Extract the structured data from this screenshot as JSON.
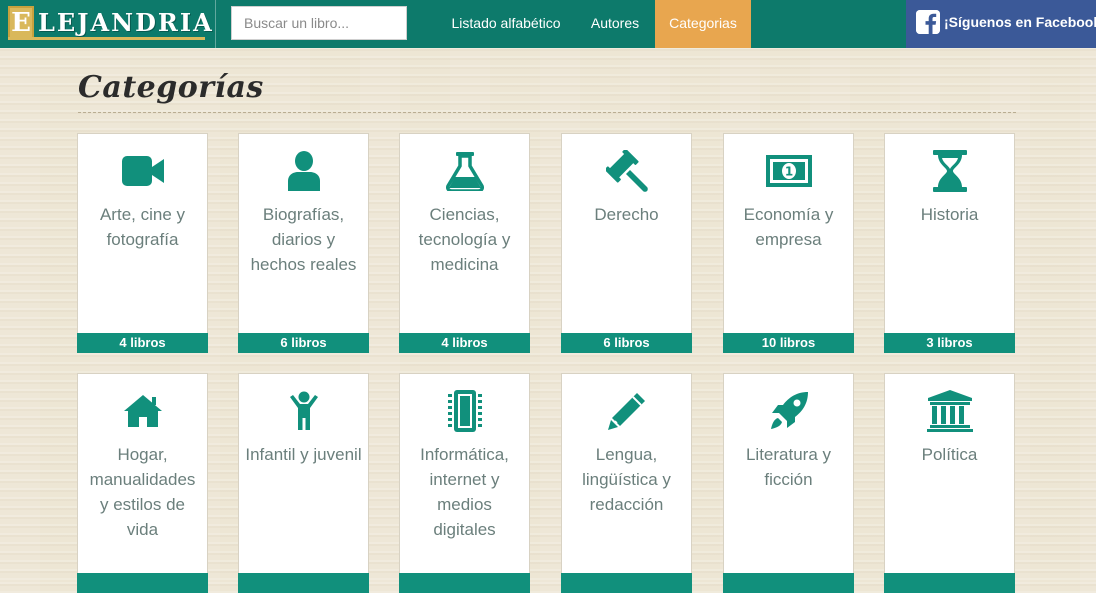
{
  "header": {
    "logo_first_letter": "E",
    "logo_rest": "LEJANDRIA",
    "search_placeholder": "Buscar un libro...",
    "nav": [
      "Listado alfabético",
      "Autores",
      "Categorias"
    ],
    "active_nav": "Categorias",
    "facebook_label": "¡Síguenos en Facebook!"
  },
  "page": {
    "title": "Categorías"
  },
  "categories": [
    {
      "title": "Arte, cine y fotografía",
      "count": "4 libros",
      "icon": "video-camera-icon"
    },
    {
      "title": "Biografías, diarios y hechos reales",
      "count": "6 libros",
      "icon": "user-icon"
    },
    {
      "title": "Ciencias, tecnología y medicina",
      "count": "4 libros",
      "icon": "flask-icon"
    },
    {
      "title": "Derecho",
      "count": "6 libros",
      "icon": "gavel-icon"
    },
    {
      "title": "Economía y empresa",
      "count": "10 libros",
      "icon": "money-icon"
    },
    {
      "title": "Historia",
      "count": "3 libros",
      "icon": "hourglass-icon"
    },
    {
      "title": "Hogar, manualidades y estilos de vida",
      "count": "",
      "icon": "home-icon"
    },
    {
      "title": "Infantil y juvenil",
      "count": "",
      "icon": "child-icon"
    },
    {
      "title": "Informática, internet y medios digitales",
      "count": "",
      "icon": "microchip-icon"
    },
    {
      "title": "Lengua, lingüística y redacción",
      "count": "",
      "icon": "pencil-icon"
    },
    {
      "title": "Literatura y ficción",
      "count": "",
      "icon": "rocket-icon"
    },
    {
      "title": "Política",
      "count": "",
      "icon": "institution-icon"
    }
  ],
  "colors": {
    "header_bg": "#0d7a6b",
    "nav_active_bg": "#e8a64f",
    "facebook_bg": "#3b5998",
    "icon_color": "#11907c",
    "count_bar_bg": "#11907c",
    "card_text": "#6b7f7c"
  }
}
